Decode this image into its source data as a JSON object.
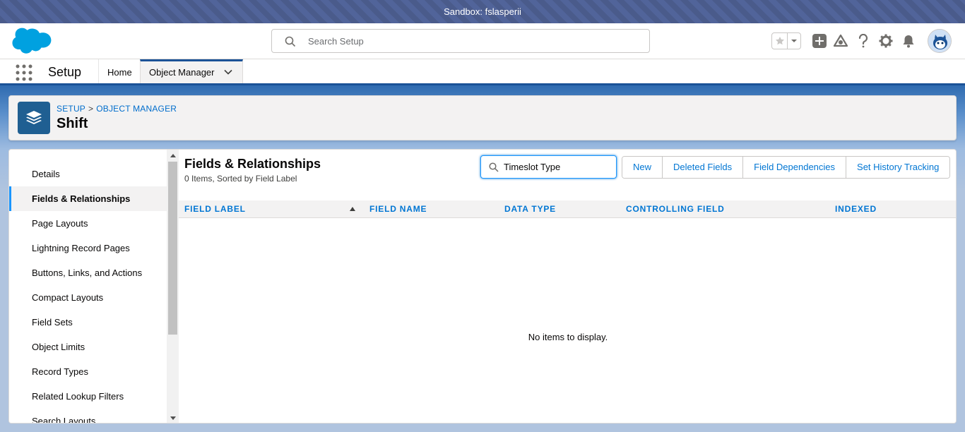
{
  "sandbox_banner": "Sandbox: fslasperii",
  "global_header": {
    "search_placeholder": "Search Setup"
  },
  "nav": {
    "app_name": "Setup",
    "tabs": [
      {
        "label": "Home"
      },
      {
        "label": "Object Manager"
      }
    ]
  },
  "page_header": {
    "breadcrumb": [
      "SETUP",
      "OBJECT MANAGER"
    ],
    "breadcrumb_separator": ">",
    "title": "Shift"
  },
  "sidebar": {
    "items": [
      {
        "label": "Details"
      },
      {
        "label": "Fields & Relationships",
        "active": true
      },
      {
        "label": "Page Layouts"
      },
      {
        "label": "Lightning Record Pages"
      },
      {
        "label": "Buttons, Links, and Actions"
      },
      {
        "label": "Compact Layouts"
      },
      {
        "label": "Field Sets"
      },
      {
        "label": "Object Limits"
      },
      {
        "label": "Record Types"
      },
      {
        "label": "Related Lookup Filters"
      },
      {
        "label": "Search Layouts"
      }
    ]
  },
  "content": {
    "title": "Fields & Relationships",
    "subtitle": "0 Items, Sorted by Field Label",
    "quick_find_value": "Timeslot Type",
    "buttons": [
      "New",
      "Deleted Fields",
      "Field Dependencies",
      "Set History Tracking"
    ],
    "columns": [
      "FIELD LABEL",
      "FIELD NAME",
      "DATA TYPE",
      "CONTROLLING FIELD",
      "INDEXED"
    ],
    "empty_message": "No items to display."
  },
  "colors": {
    "brand_blue": "#0176d3",
    "nav_border": "#1b5297",
    "salesforce_cloud": "#00a1e0",
    "object_icon_bg": "#1f5f92"
  }
}
